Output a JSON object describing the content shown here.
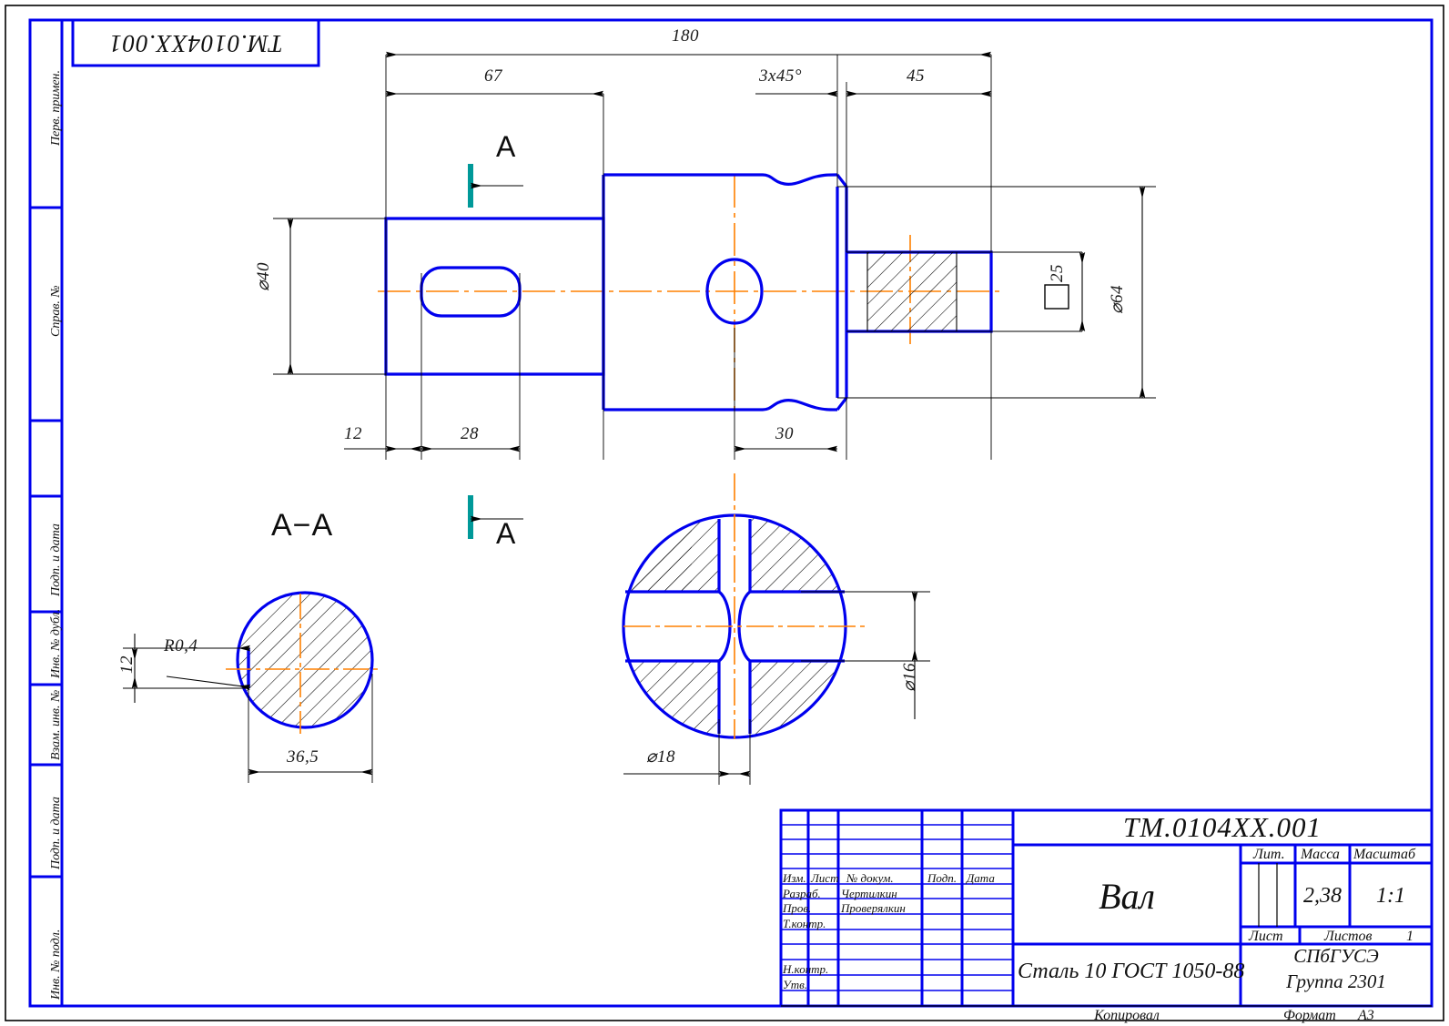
{
  "sheet": {
    "format": "A3",
    "frame_color": "#0000ee",
    "part_color": "#0000ee",
    "axis_color": "#ff8000",
    "section_marker_color": "#009999",
    "thin_line_color": "#000000"
  },
  "corner_box": {
    "label": "ТМ.0104ХХ.001"
  },
  "side_column": {
    "labels": [
      "Перв. примен.",
      "Справ. №",
      "Подп. и дата",
      "Инв. № дубл.",
      "Взам. инв. №",
      "Подп. и дата",
      "Инв. № подл."
    ]
  },
  "drawing": {
    "title_main_view": "",
    "section_label_top": "A",
    "section_label_bottom": "A",
    "section_view_title": "A−A",
    "dimensions": {
      "overall_length": "180",
      "left_step_length": "67",
      "chamfer": "3x45°",
      "right_step_length": "45",
      "keyway_offset": "12",
      "keyway_length": "28",
      "hole_position": "30",
      "big_diameter": "⌀40",
      "flange_diameter": "⌀64",
      "square_size": "25",
      "square_symbol": "□",
      "section_radius": "R0,4",
      "section_flat_width": "12",
      "section_width": "36,5",
      "bore_diameter": "⌀16",
      "hub_diameter": "⌀18"
    }
  },
  "title_block": {
    "document_number": "ТМ.0104ХХ.001",
    "part_name": "Вал",
    "material": "Сталь 10  ГОСТ 1050-88",
    "organization_line1": "СПбГУСЭ",
    "organization_line2": "Группа 2301",
    "revision_headers": [
      "Изм.",
      "Лист",
      "№ докум.",
      "Подп.",
      "Дата"
    ],
    "roles": [
      {
        "role": "Разраб.",
        "name": "Чертилкин"
      },
      {
        "role": "Пров.",
        "name": "Проверялкин"
      },
      {
        "role": "Т.контр.",
        "name": ""
      },
      {
        "role": "",
        "name": ""
      },
      {
        "role": "Н.контр.",
        "name": ""
      },
      {
        "role": "Утв.",
        "name": ""
      }
    ],
    "right_headers": [
      "Лит.",
      "Масса",
      "Масштаб"
    ],
    "mass_value": "2,38",
    "scale_value": "1:1",
    "sheet_label": "Лист",
    "sheets_label": "Листов",
    "sheets_value": "1",
    "copied_label": "Копировал",
    "format_label": "Формат",
    "format_value": "А3"
  }
}
